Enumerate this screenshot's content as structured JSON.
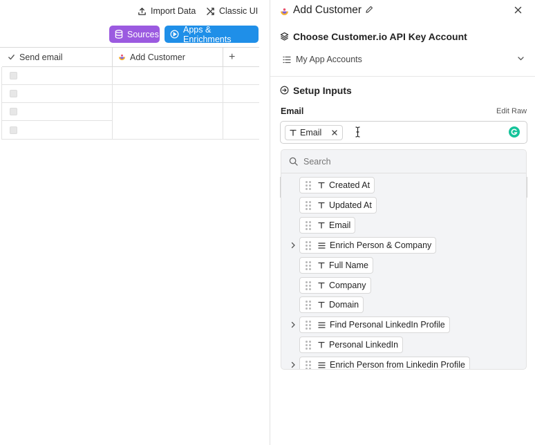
{
  "toolbar": {
    "import_label": "Import Data",
    "classic_label": "Classic UI",
    "sources_label": "Sources",
    "apps_label": "Apps & Enrichments"
  },
  "grid": {
    "columns": [
      "Send email",
      "Add Customer"
    ],
    "add_column": "+"
  },
  "panel": {
    "title": "Add Customer",
    "section1_title": "Choose Customer.io API Key Account",
    "account_select": "My App Accounts",
    "section2_title": "Setup Inputs",
    "email_label": "Email",
    "edit_raw": "Edit Raw",
    "email_chip": "Email"
  },
  "dropdown": {
    "search_placeholder": "Search",
    "items": [
      {
        "label": "Created At",
        "type": "text",
        "expandable": false
      },
      {
        "label": "Updated At",
        "type": "text",
        "expandable": false
      },
      {
        "label": "Email",
        "type": "text",
        "expandable": false
      },
      {
        "label": "Enrich Person & Company",
        "type": "list",
        "expandable": true
      },
      {
        "label": "Full Name",
        "type": "text",
        "expandable": false
      },
      {
        "label": "Company",
        "type": "text",
        "expandable": false
      },
      {
        "label": "Domain",
        "type": "text",
        "expandable": false
      },
      {
        "label": "Find Personal LinkedIn Profile",
        "type": "list",
        "expandable": true
      },
      {
        "label": "Personal LinkedIn",
        "type": "text",
        "expandable": false
      },
      {
        "label": "Enrich Person from Linkedin Profile",
        "type": "list",
        "expandable": true
      }
    ]
  },
  "colors": {
    "sources_bg": "#9b5ae0",
    "apps_bg": "#1f8fe8",
    "grammarly": "#15c39a"
  }
}
